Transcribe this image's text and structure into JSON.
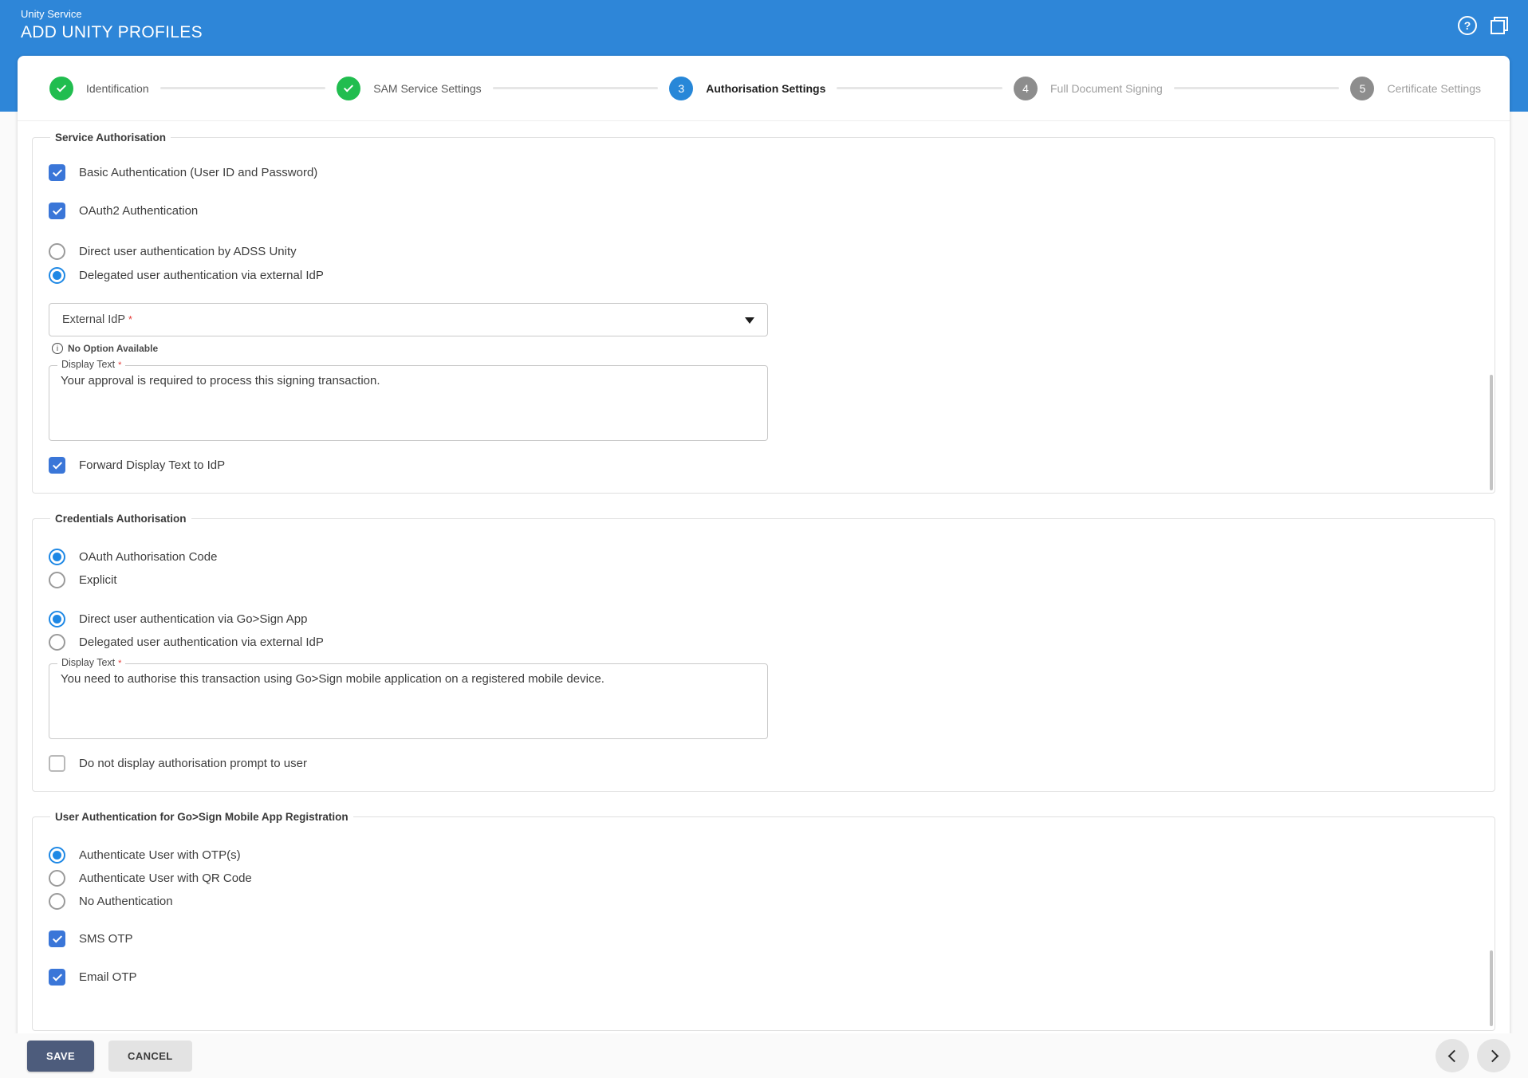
{
  "header": {
    "app_name": "Unity Service",
    "title": "ADD UNITY PROFILES"
  },
  "stepper": {
    "steps": [
      {
        "label": "Identification",
        "number": "",
        "state": "complete"
      },
      {
        "label": "SAM Service Settings",
        "number": "",
        "state": "complete"
      },
      {
        "label": "Authorisation Settings",
        "number": "3",
        "state": "active"
      },
      {
        "label": "Full Document Signing",
        "number": "4",
        "state": "pending"
      },
      {
        "label": "Certificate Settings",
        "number": "5",
        "state": "pending"
      }
    ]
  },
  "service_authorisation": {
    "legend": "Service Authorisation",
    "basic_auth_label": "Basic Authentication (User ID and Password)",
    "oauth2_label": "OAuth2 Authentication",
    "direct_user_label": "Direct user authentication by ADSS Unity",
    "delegated_user_label": "Delegated user authentication via external IdP",
    "external_idp_label": "External IdP",
    "required_marker": "*",
    "no_option_hint": "No Option Available",
    "display_text_label": "Display Text",
    "display_text_value": "Your approval is required to process this signing transaction.",
    "forward_label": "Forward Display Text to IdP"
  },
  "credentials_authorisation": {
    "legend": "Credentials Authorisation",
    "oauth_code_label": "OAuth Authorisation Code",
    "explicit_label": "Explicit",
    "direct_gosign_label": "Direct user authentication via Go>Sign App",
    "delegated_idp_label": "Delegated user authentication via external IdP",
    "display_text_label": "Display Text",
    "required_marker": "*",
    "display_text_value": "You need to authorise this transaction using Go>Sign mobile application on a registered mobile device.",
    "no_prompt_label": "Do not display authorisation prompt to user"
  },
  "gosign_registration": {
    "legend": "User Authentication for Go>Sign Mobile App Registration",
    "otp_label": "Authenticate User with OTP(s)",
    "qr_label": "Authenticate User with QR Code",
    "none_label": "No Authentication",
    "sms_otp_label": "SMS OTP",
    "email_otp_label": "Email OTP"
  },
  "footer": {
    "save_label": "SAVE",
    "cancel_label": "CANCEL"
  },
  "colors": {
    "header_blue": "#2e86d8",
    "step_active_blue": "#2787d8",
    "step_complete_green": "#21bd4f",
    "step_pending_grey": "#8d8d8d",
    "checkbox_blue": "#3a76d8",
    "radio_blue": "#1e88e5",
    "save_button_bg": "#4d5c7c",
    "required_red": "#e53935"
  }
}
